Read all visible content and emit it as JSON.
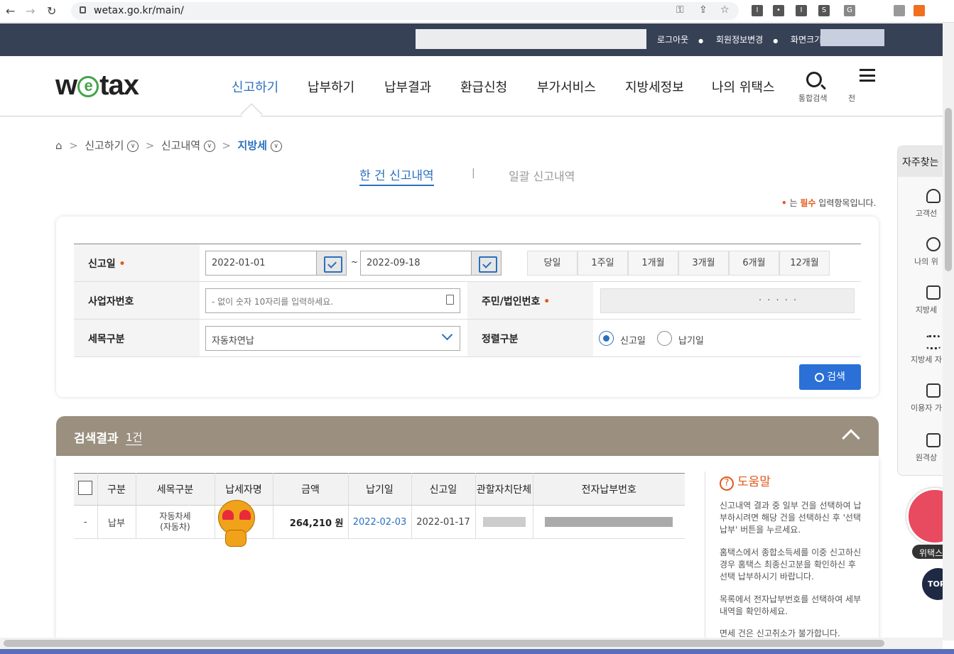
{
  "browser": {
    "url": "wetax.go.kr/main/"
  },
  "topbar": {
    "logout": "로그아웃",
    "edit_member": "회원정보변경",
    "screen_size": "화면크기"
  },
  "header": {
    "logo": "wetax",
    "menu": [
      "신고하기",
      "납부하기",
      "납부결과",
      "환급신청",
      "부가서비스",
      "지방세정보",
      "나의 위택스"
    ],
    "search_label": "통합검색",
    "all_menu_label": "전"
  },
  "breadcrumb": [
    "신고하기",
    "신고내역",
    "지방세"
  ],
  "tabs": {
    "single": "한 건 신고내역",
    "bulk": "일괄 신고내역"
  },
  "required_note": {
    "dot": "•",
    "pre": "는",
    "bold": "필수",
    "post": "입력항목입니다."
  },
  "form": {
    "report_date_label": "신고일",
    "date_from": "2022-01-01",
    "date_sep": "~",
    "date_to": "2022-09-18",
    "periods": [
      "당일",
      "1주일",
      "1개월",
      "3개월",
      "6개월",
      "12개월"
    ],
    "biz_no_label": "사업자번호",
    "biz_no_placeholder": "- 없이 숫자 10자리를 입력하세요.",
    "resident_no_label": "주민/법인번호",
    "resident_no_masked": "· · · · ·",
    "tax_type_label": "세목구분",
    "tax_type_value": "자동차연납",
    "sort_label": "정렬구분",
    "sort_options": [
      "신고일",
      "납기일"
    ],
    "search_button": "검색"
  },
  "results": {
    "title": "검색결과",
    "count": "1건",
    "columns": [
      "구분",
      "세목구분",
      "납세자명",
      "금액",
      "납기일",
      "신고일",
      "관할자치단체",
      "전자납부번호"
    ],
    "rows": [
      {
        "mark": "-",
        "type": "납부",
        "tax_type_1": "자동차세",
        "tax_type_2": "(자동차)",
        "amount": "264,210 원",
        "due_date": "2022-02-03",
        "report_date": "2022-01-17"
      }
    ]
  },
  "help": {
    "title": "도움말",
    "items": [
      "신고내역 결과 중 일부 건을 선택하여 납부하시려면 해당 건을 선택하신 후 '선택납부' 버튼을 누르세요.",
      "홈택스에서 종합소득세를 이중 신고하신 경우 홈택스 최종신고분을 확인하신 후 선택 납부하시기 바랍니다.",
      "목록에서 전자납부번호를 선택하여 세부내역을 확인하세요.",
      "면세 건은 신고취소가 불가합니다."
    ]
  },
  "side": {
    "title": "자주찾는",
    "items": [
      "고객선",
      "나의 위",
      "지방세",
      "지방세 자",
      "이용자 가",
      "원격상"
    ],
    "mascot_label": "위택스",
    "top": "TOP"
  },
  "colors": {
    "topbar": "#374155",
    "accent": "#2a70bf",
    "required": "#e05a1c",
    "results_header": "#9b907f"
  }
}
